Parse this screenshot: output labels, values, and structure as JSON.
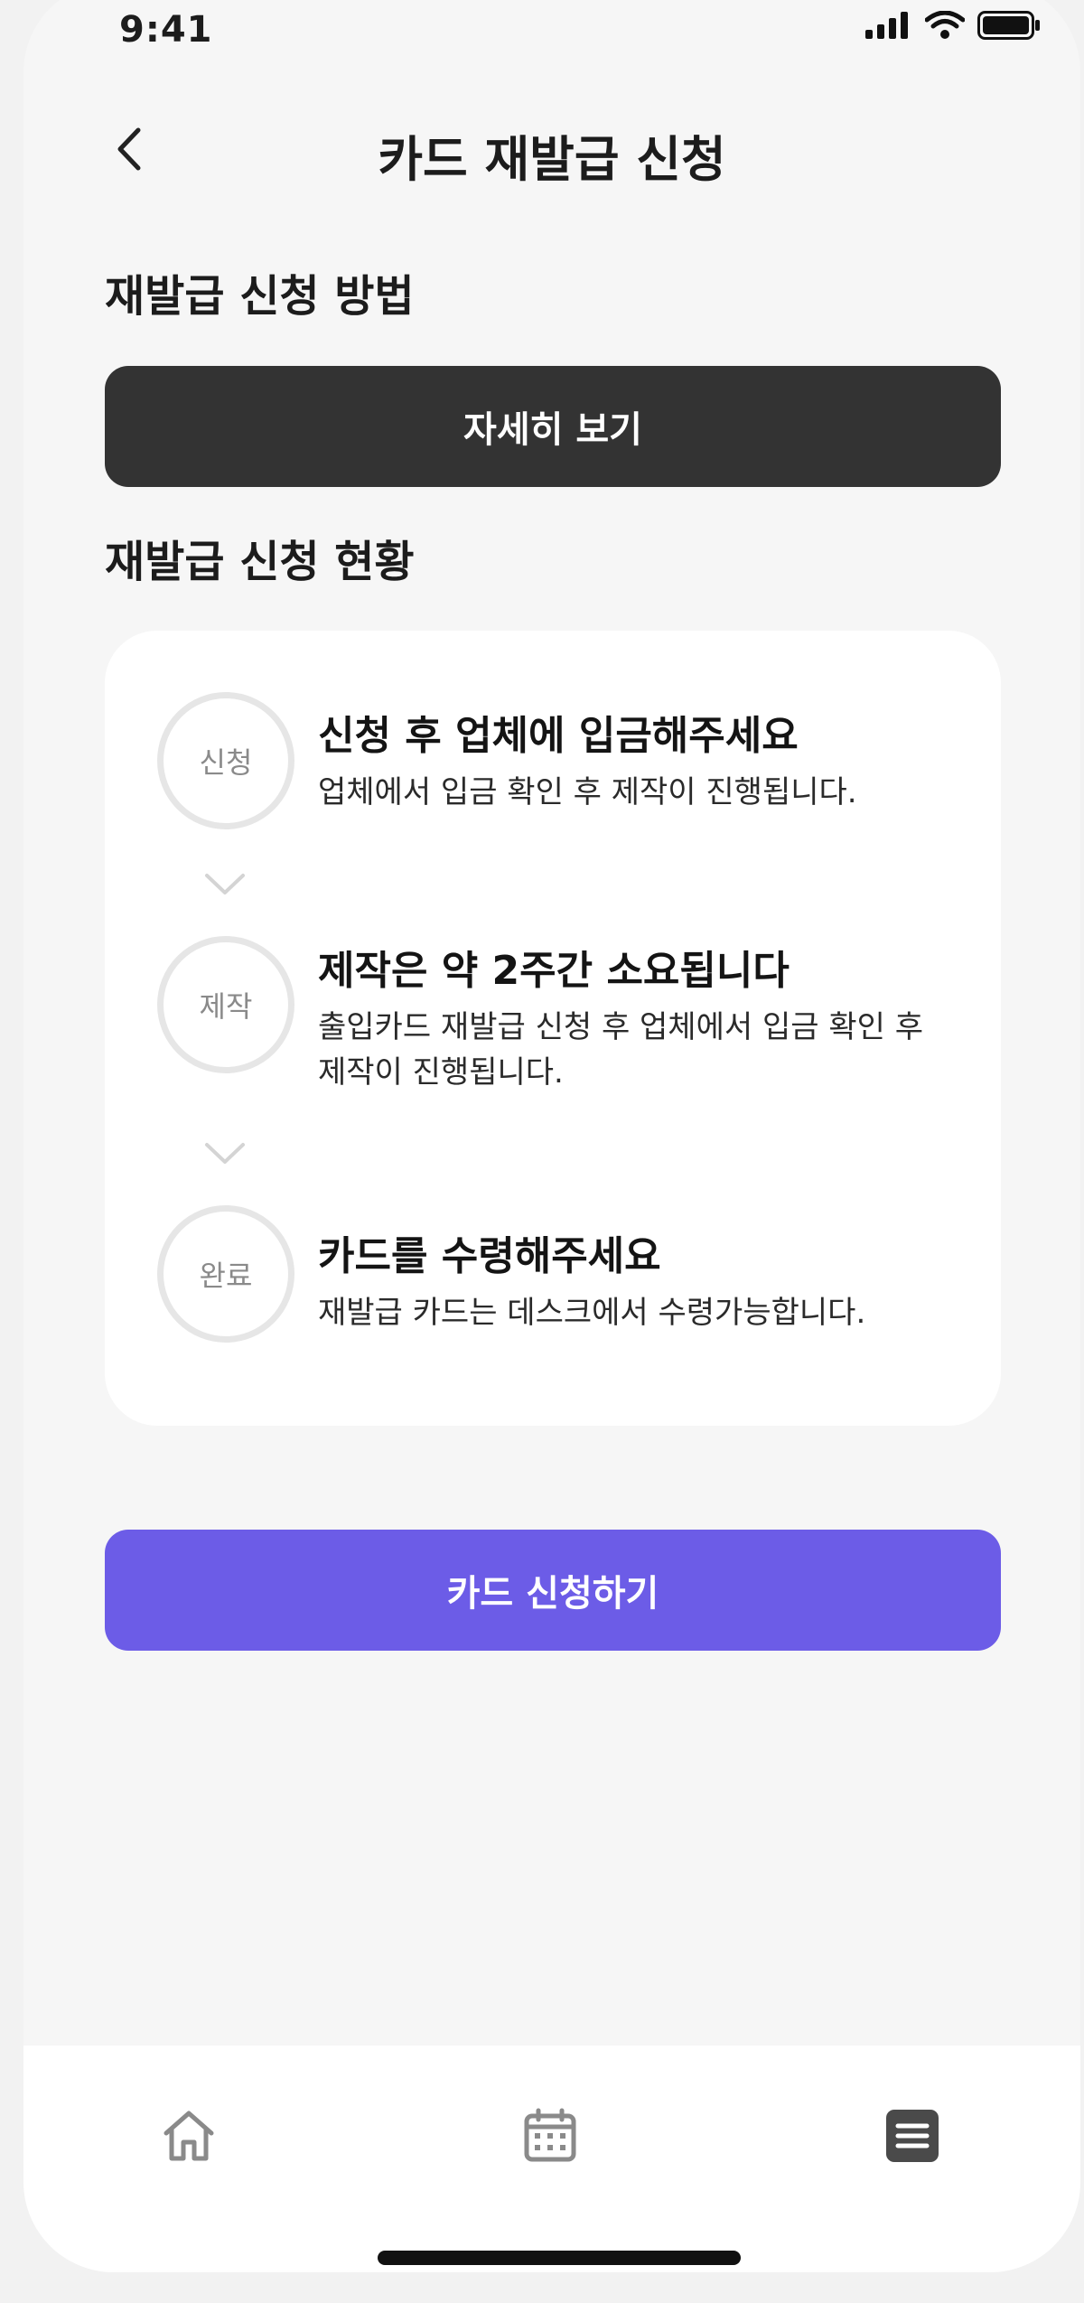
{
  "status_bar": {
    "time": "9:41"
  },
  "header": {
    "title": "카드 재발급 신청",
    "back_icon": "chevron-left-icon"
  },
  "method_section": {
    "title": "재발급 신청 방법",
    "detail_button_label": "자세히 보기"
  },
  "status_section": {
    "title": "재발급 신청 현황",
    "steps": [
      {
        "badge": "신청",
        "title": "신청 후 업체에 입금해주세요",
        "desc": "업체에서 입금 확인 후 제작이 진행됩니다."
      },
      {
        "badge": "제작",
        "title": "제작은 약 2주간 소요됩니다",
        "desc": "출입카드 재발급 신청 후 업체에서 입금 확인 후 제작이 진행됩니다."
      },
      {
        "badge": "완료",
        "title": "카드를 수령해주세요",
        "desc": "재발급 카드는 데스크에서 수령가능합니다."
      }
    ]
  },
  "apply_button_label": "카드 신청하기",
  "tab_bar": {
    "items": [
      "home-icon",
      "calendar-icon",
      "list-icon"
    ]
  },
  "colors": {
    "primary": "#6c5ce7",
    "dark_button": "#333333",
    "background": "#f6f6f6",
    "card": "#ffffff"
  }
}
